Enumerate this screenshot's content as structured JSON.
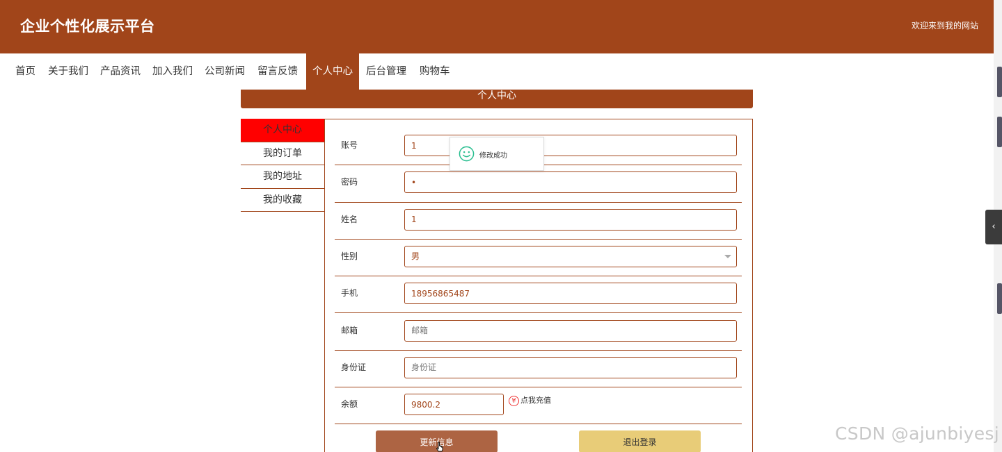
{
  "header": {
    "site_title": "企业个性化展示平台",
    "welcome": "欢迎来到我的网站"
  },
  "nav": {
    "items": [
      {
        "label": "首页"
      },
      {
        "label": "关于我们"
      },
      {
        "label": "产品资讯"
      },
      {
        "label": "加入我们"
      },
      {
        "label": "公司新闻"
      },
      {
        "label": "留言反馈"
      },
      {
        "label": "个人中心",
        "active": true
      },
      {
        "label": "后台管理"
      },
      {
        "label": "购物车"
      }
    ]
  },
  "panel": {
    "title": "个人中心"
  },
  "side_menu": {
    "items": [
      {
        "label": "个人中心",
        "active": true
      },
      {
        "label": "我的订单"
      },
      {
        "label": "我的地址"
      },
      {
        "label": "我的收藏"
      }
    ]
  },
  "form": {
    "account": {
      "label": "账号",
      "value": "1"
    },
    "password": {
      "label": "密码",
      "value": "•"
    },
    "name": {
      "label": "姓名",
      "value": "1"
    },
    "gender": {
      "label": "性别",
      "value": "男"
    },
    "phone": {
      "label": "手机",
      "value": "18956865487"
    },
    "email": {
      "label": "邮箱",
      "value": "",
      "placeholder": "邮箱"
    },
    "id_card": {
      "label": "身份证",
      "value": "",
      "placeholder": "身份证"
    },
    "balance": {
      "label": "余额",
      "value": "9800.2",
      "recharge_label": "点我充值"
    }
  },
  "buttons": {
    "update": "更新信息",
    "logout": "退出登录"
  },
  "toast": {
    "message": "修改成功"
  },
  "watermark": "CSDN @ajunbiyesj",
  "colors": {
    "brand": "#a1451a",
    "active_side": "#ff0000",
    "update_button": "#ad6443",
    "logout_button": "#e8cc78",
    "success_icon": "#2bbf91"
  }
}
